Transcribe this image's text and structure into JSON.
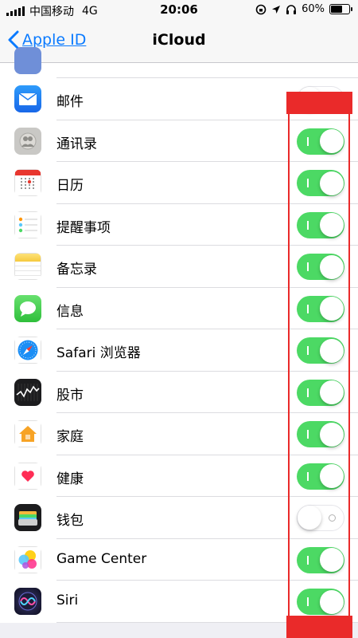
{
  "status_bar": {
    "carrier": "中国移动",
    "network": "4G",
    "time": "20:06",
    "battery_percent": "60%",
    "battery_level": 0.6
  },
  "nav": {
    "back_label": "Apple ID",
    "title": "iCloud"
  },
  "rows": [
    {
      "label": "邮件",
      "icon": "mail-icon",
      "enabled": false
    },
    {
      "label": "通讯录",
      "icon": "contacts-icon",
      "enabled": true
    },
    {
      "label": "日历",
      "icon": "calendar-icon",
      "enabled": true
    },
    {
      "label": "提醒事项",
      "icon": "reminders-icon",
      "enabled": true
    },
    {
      "label": "备忘录",
      "icon": "notes-icon",
      "enabled": true
    },
    {
      "label": "信息",
      "icon": "messages-icon",
      "enabled": true
    },
    {
      "label": "Safari 浏览器",
      "icon": "safari-icon",
      "enabled": true
    },
    {
      "label": "股市",
      "icon": "stocks-icon",
      "enabled": true
    },
    {
      "label": "家庭",
      "icon": "home-icon",
      "enabled": true
    },
    {
      "label": "健康",
      "icon": "health-icon",
      "enabled": true
    },
    {
      "label": "钱包",
      "icon": "wallet-icon",
      "enabled": false
    },
    {
      "label": "Game Center",
      "icon": "game-center-icon",
      "enabled": true
    },
    {
      "label": "Siri",
      "icon": "siri-icon",
      "enabled": true
    }
  ],
  "colors": {
    "accent": "#0a7aff",
    "toggle_on": "#4cd964",
    "annotation": "#ea2a2a"
  }
}
